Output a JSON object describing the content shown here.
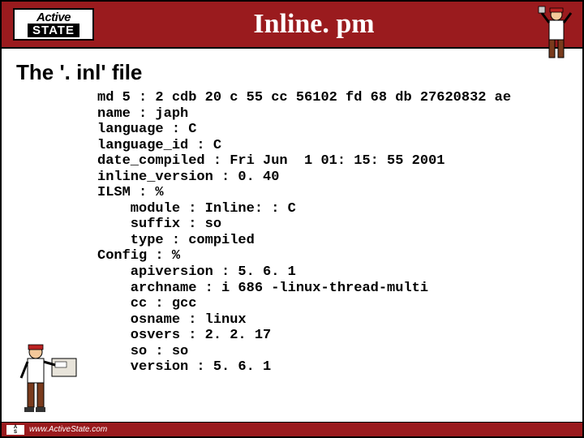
{
  "header": {
    "logo_top": "Active",
    "logo_bottom": "STATE",
    "title": "Inline. pm"
  },
  "subtitle": "The '. inl' file",
  "code_lines": [
    "md 5 : 2 cdb 20 c 55 cc 56102 fd 68 db 27620832 ae",
    "name : japh",
    "language : C",
    "language_id : C",
    "date_compiled : Fri Jun  1 01: 15: 55 2001",
    "inline_version : 0. 40",
    "ILSM : %",
    "    module : Inline: : C",
    "    suffix : so",
    "    type : compiled",
    "Config : %",
    "    apiversion : 5. 6. 1",
    "    archname : i 686 -linux-thread-multi",
    "    cc : gcc",
    "    osname : linux",
    "    osvers : 2. 2. 17",
    "    so : so",
    "    version : 5. 6. 1"
  ],
  "footer": {
    "url": "www.ActiveState.com"
  }
}
